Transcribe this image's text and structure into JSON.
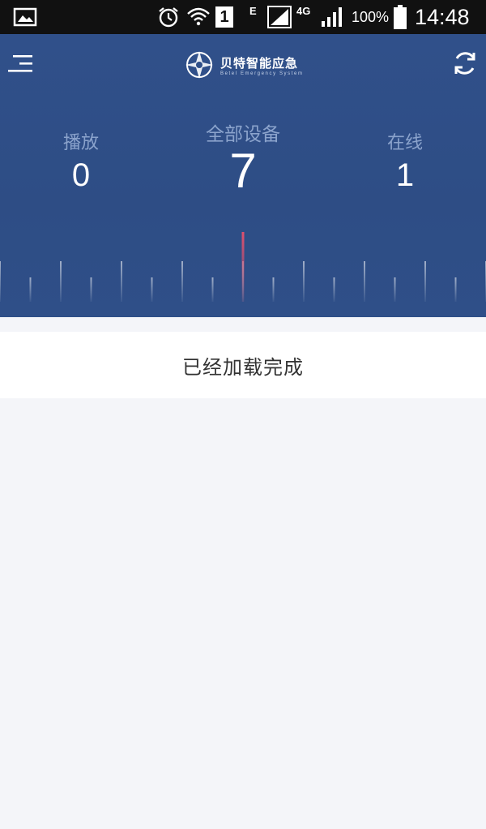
{
  "status_bar": {
    "sim_slot": "1",
    "network_e": "E",
    "network_4g": "4G",
    "battery": "100%",
    "time": "14:48",
    "icons": [
      "gallery-icon",
      "alarm-icon",
      "wifi-icon",
      "sim-icon",
      "signal-icon",
      "battery-icon"
    ]
  },
  "header": {
    "brand": "贝特智能应急",
    "brand_sub": "Betel Emergency System",
    "icons": {
      "menu": "menu-icon",
      "refresh": "refresh-icon",
      "logo": "compass-logo-icon"
    }
  },
  "stats": {
    "playing": {
      "label": "播放",
      "value": "0"
    },
    "total": {
      "label": "全部设备",
      "value": "7"
    },
    "online": {
      "label": "在线",
      "value": "1"
    }
  },
  "gauge": {
    "level": 0.5,
    "indicator_color": "#e0506e"
  },
  "notice": {
    "text": "已经加载完成"
  },
  "colors": {
    "header_bg": "#2f4f88",
    "label": "#8ba3cc",
    "page_bg": "#f4f5f9"
  }
}
